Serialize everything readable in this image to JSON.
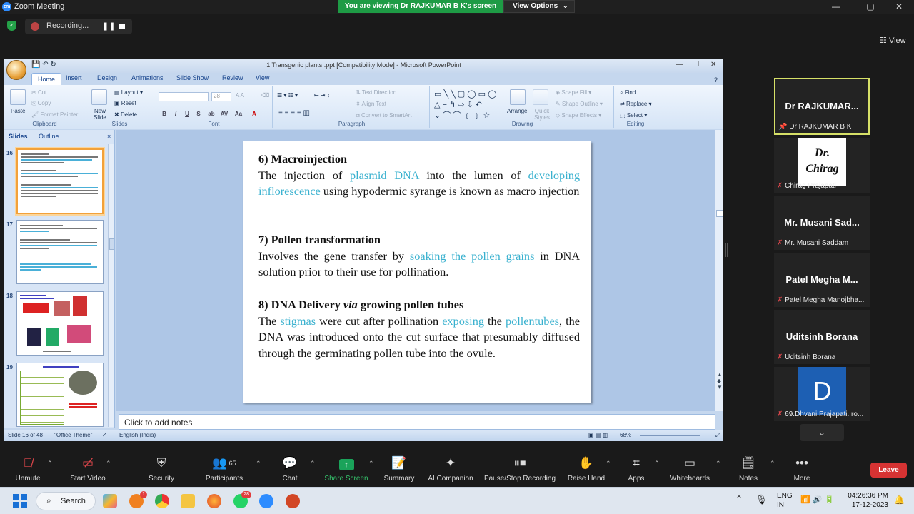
{
  "zoom": {
    "window_title": "Zoom Meeting",
    "viewing_banner": "You are viewing Dr RAJKUMAR B K's screen",
    "view_options": "View Options",
    "recording_label": "Recording...",
    "view_label": "View",
    "colors": {
      "banner": "#1e9b45",
      "leave": "#d63333",
      "share": "#1aa35a",
      "active_speaker": "#d6e067"
    }
  },
  "ppt": {
    "title": "1 Transgenic plants .ppt [Compatibility Mode] - Microsoft PowerPoint",
    "tabs": [
      "Home",
      "Insert",
      "Design",
      "Animations",
      "Slide Show",
      "Review",
      "View"
    ],
    "ribbon": {
      "clipboard": {
        "paste": "Paste",
        "cut": "Cut",
        "copy": "Copy",
        "format_painter": "Format Painter",
        "label": "Clipboard"
      },
      "slides": {
        "new_slide": "New Slide",
        "layout": "Layout",
        "reset": "Reset",
        "delete": "Delete",
        "label": "Slides"
      },
      "font": {
        "size": "28",
        "label": "Font"
      },
      "paragraph": {
        "text_direction": "Text Direction",
        "align_text": "Align Text",
        "convert": "Convert to SmartArt",
        "label": "Paragraph"
      },
      "drawing": {
        "arrange": "Arrange",
        "quick_styles": "Quick Styles",
        "shape_fill": "Shape Fill",
        "shape_outline": "Shape Outline",
        "shape_effects": "Shape Effects",
        "label": "Drawing"
      },
      "editing": {
        "find": "Find",
        "replace": "Replace",
        "select": "Select",
        "label": "Editing"
      }
    },
    "panel_tabs": {
      "slides": "Slides",
      "outline": "Outline"
    },
    "thumbnails": [
      {
        "num": "16"
      },
      {
        "num": "17"
      },
      {
        "num": "18"
      },
      {
        "num": "19"
      }
    ],
    "slide": {
      "s6_head": "6) Macroinjection",
      "s6_t1": "The injection of ",
      "s6_h1": "plasmid DNA",
      "s6_t2": " into the lumen of ",
      "s6_h2": "developing inflorescence",
      "s6_t3": " using hypodermic syrange is known as macro injection",
      "s7_head": "7) Pollen transformation",
      "s7_t1": "Involves the gene transfer by ",
      "s7_h1": "soaking the pollen grains",
      "s7_t2": " in DNA solution prior to their use for pollination.",
      "s8_head1": "8) DNA Delivery ",
      "s8_head_it": "via",
      "s8_head2": " growing pollen tubes",
      "s8_t1": "The ",
      "s8_h1": "stigmas",
      "s8_t2": " were cut after pollination ",
      "s8_h2": "exposing",
      "s8_t3": " the ",
      "s8_h3": "pollentubes",
      "s8_t4": ", the DNA was introduced onto the cut surface that presumably diffused through the germinating pollen tube into the ovule."
    },
    "notes_placeholder": "Click to add notes",
    "status": {
      "slide": "Slide 16 of 48",
      "theme": "\"Office Theme\"",
      "language": "English (India)",
      "zoom": "68%"
    }
  },
  "participants": [
    {
      "big": "Dr  RAJKUMAR...",
      "small": "Dr RAJKUMAR B K"
    },
    {
      "avatar1": "Dr.",
      "avatar2": "Chirag",
      "small": "Chirag Prajapati"
    },
    {
      "big": "Mr. Musani Sad...",
      "small": "Mr. Musani Saddam"
    },
    {
      "big": "Patel Megha M...",
      "small": "Patel Megha Manojbha..."
    },
    {
      "big": "Uditsinh Borana",
      "small": "Uditsinh Borana"
    },
    {
      "avatar": "D",
      "small": "69.Dhvani Prajapati. ro..."
    }
  ],
  "toolbar": {
    "unmute": "Unmute",
    "start_video": "Start Video",
    "security": "Security",
    "participants": "Participants",
    "participants_count": "65",
    "chat": "Chat",
    "share_screen": "Share Screen",
    "summary": "Summary",
    "ai_companion": "AI Companion",
    "pause_stop": "Pause/Stop Recording",
    "raise_hand": "Raise Hand",
    "apps": "Apps",
    "whiteboards": "Whiteboards",
    "notes": "Notes",
    "more": "More",
    "leave": "Leave"
  },
  "taskbar": {
    "search": "Search",
    "lang1": "ENG",
    "lang2": "IN",
    "time": "04:26:36 PM",
    "date": "17-12-2023",
    "whatsapp_badge": "28",
    "firefox_badge": "1"
  }
}
